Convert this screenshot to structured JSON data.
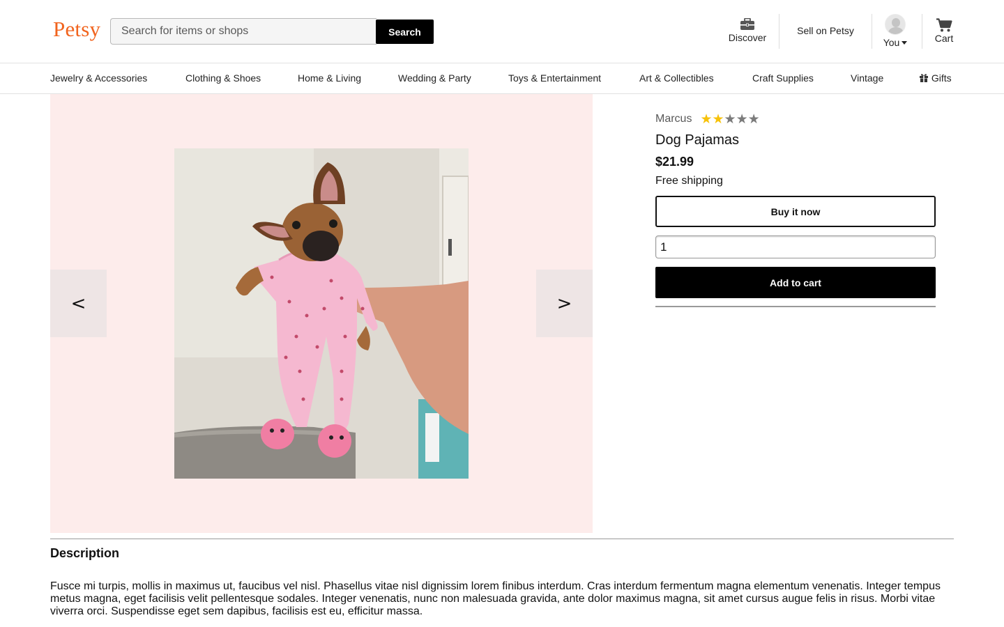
{
  "header": {
    "logo": "Petsy",
    "search_placeholder": "Search for items or shops",
    "search_button": "Search",
    "discover_label": "Discover",
    "sell_label": "Sell on Petsy",
    "you_label": "You",
    "cart_label": "Cart"
  },
  "categories": [
    {
      "label": "Jewelry & Accessories"
    },
    {
      "label": "Clothing & Shoes"
    },
    {
      "label": "Home & Living"
    },
    {
      "label": "Wedding & Party"
    },
    {
      "label": "Toys & Entertainment"
    },
    {
      "label": "Art & Collectibles"
    },
    {
      "label": "Craft Supplies"
    },
    {
      "label": "Vintage"
    },
    {
      "label": "Gifts",
      "icon": "gift-icon"
    }
  ],
  "gallery": {
    "prev_label": "<",
    "next_label": ">",
    "background": "#fdeceb"
  },
  "listing": {
    "seller": "Marcus",
    "rating": 2,
    "rating_max": 5,
    "title": "Dog Pajamas",
    "price": "$21.99",
    "shipping": "Free shipping",
    "buy_now_label": "Buy it now",
    "quantity": "1",
    "add_to_cart_label": "Add to cart"
  },
  "description": {
    "heading": "Description",
    "text": "Fusce mi turpis, mollis in maximus ut, faucibus vel nisl. Phasellus vitae nisl dignissim lorem finibus interdum. Cras interdum fermentum magna elementum venenatis. Integer tempus metus magna, eget facilisis velit pellentesque sodales. Integer venenatis, nunc non malesuada gravida, ante dolor maximus magna, sit amet cursus augue felis in risus. Morbi vitae viverra orci. Suspendisse eget sem dapibus, facilisis est eu, efficitur massa."
  },
  "colors": {
    "brand": "#f1641e",
    "star_filled": "#f7c20a",
    "star_empty": "#7b7b7b"
  }
}
